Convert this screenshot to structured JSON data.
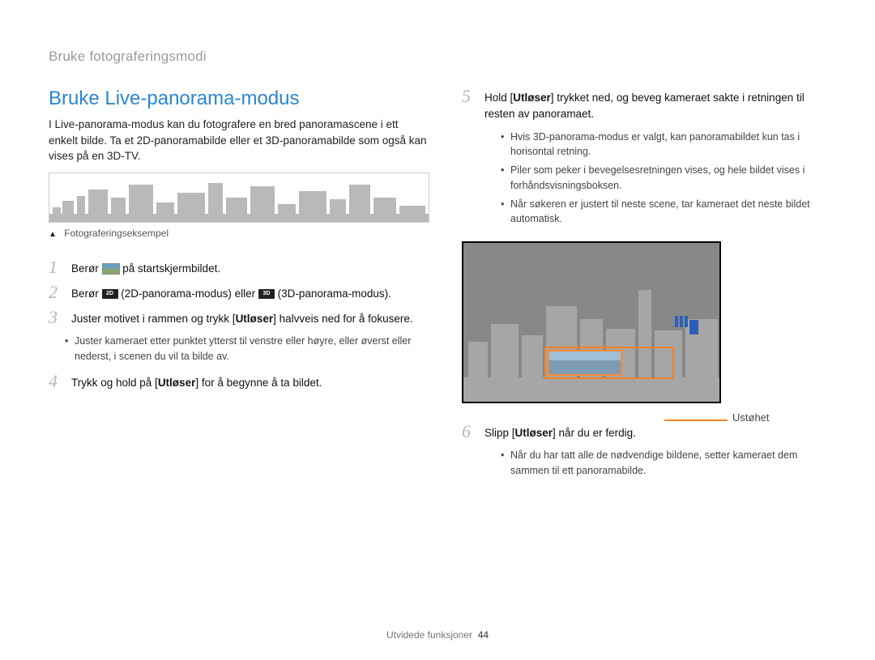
{
  "section_label": "Bruke fotograferingsmodi",
  "heading": "Bruke Live-panorama-modus",
  "intro": "I Live-panorama-modus kan du fotografere en bred panoramascene i ett enkelt bilde. Ta et 2D-panoramabilde eller et 3D-panoramabilde som også kan vises på en 3D-TV.",
  "caption": "Fotograferingseksempel",
  "steps_left": [
    {
      "num": "1",
      "text_a": "Berør ",
      "icon": "pano-icon",
      "text_b": " på startskjermbildet."
    },
    {
      "num": "2",
      "text_a": "Berør ",
      "icon": "icon-2d",
      "text_mid": " (2D-panorama-modus) eller ",
      "icon2": "icon-3d",
      "text_b": " (3D-panorama-modus)."
    },
    {
      "num": "3",
      "text_a": "Juster motivet i rammen og trykk [",
      "bold": "Utløser",
      "text_b": "] halvveis ned for å fokusere.",
      "sub": "Juster kameraet etter punktet ytterst til venstre eller høyre, eller øverst eller nederst, i scenen du vil ta bilde av."
    },
    {
      "num": "4",
      "text_a": "Trykk og hold på [",
      "bold": "Utløser",
      "text_b": "] for å begynne å ta bildet."
    }
  ],
  "step5": {
    "num": "5",
    "text_a": "Hold [",
    "bold": "Utløser",
    "text_b": "] trykket ned, og beveg kameraet sakte i retningen til resten av panoramaet.",
    "bullets": [
      "Hvis 3D-panorama-modus er valgt, kan panoramabildet kun tas i horisontal retning.",
      "Piler som peker i bevegelsesretningen vises, og hele bildet vises i forhåndsvisningsboksen.",
      "Når søkeren er justert til neste scene, tar kameraet det neste bildet automatisk."
    ]
  },
  "vf_label": "Ustøhet",
  "step6": {
    "num": "6",
    "text_a": "Slipp [",
    "bold": "Utløser",
    "text_b": "] når du er ferdig.",
    "bullets": [
      "Når du har tatt alle de nødvendige bildene, setter kameraet dem sammen til ett panoramabilde."
    ]
  },
  "footer_label": "Utvidede funksjoner",
  "footer_page": "44",
  "icon_2d_label": "2D",
  "icon_3d_label": "3D"
}
